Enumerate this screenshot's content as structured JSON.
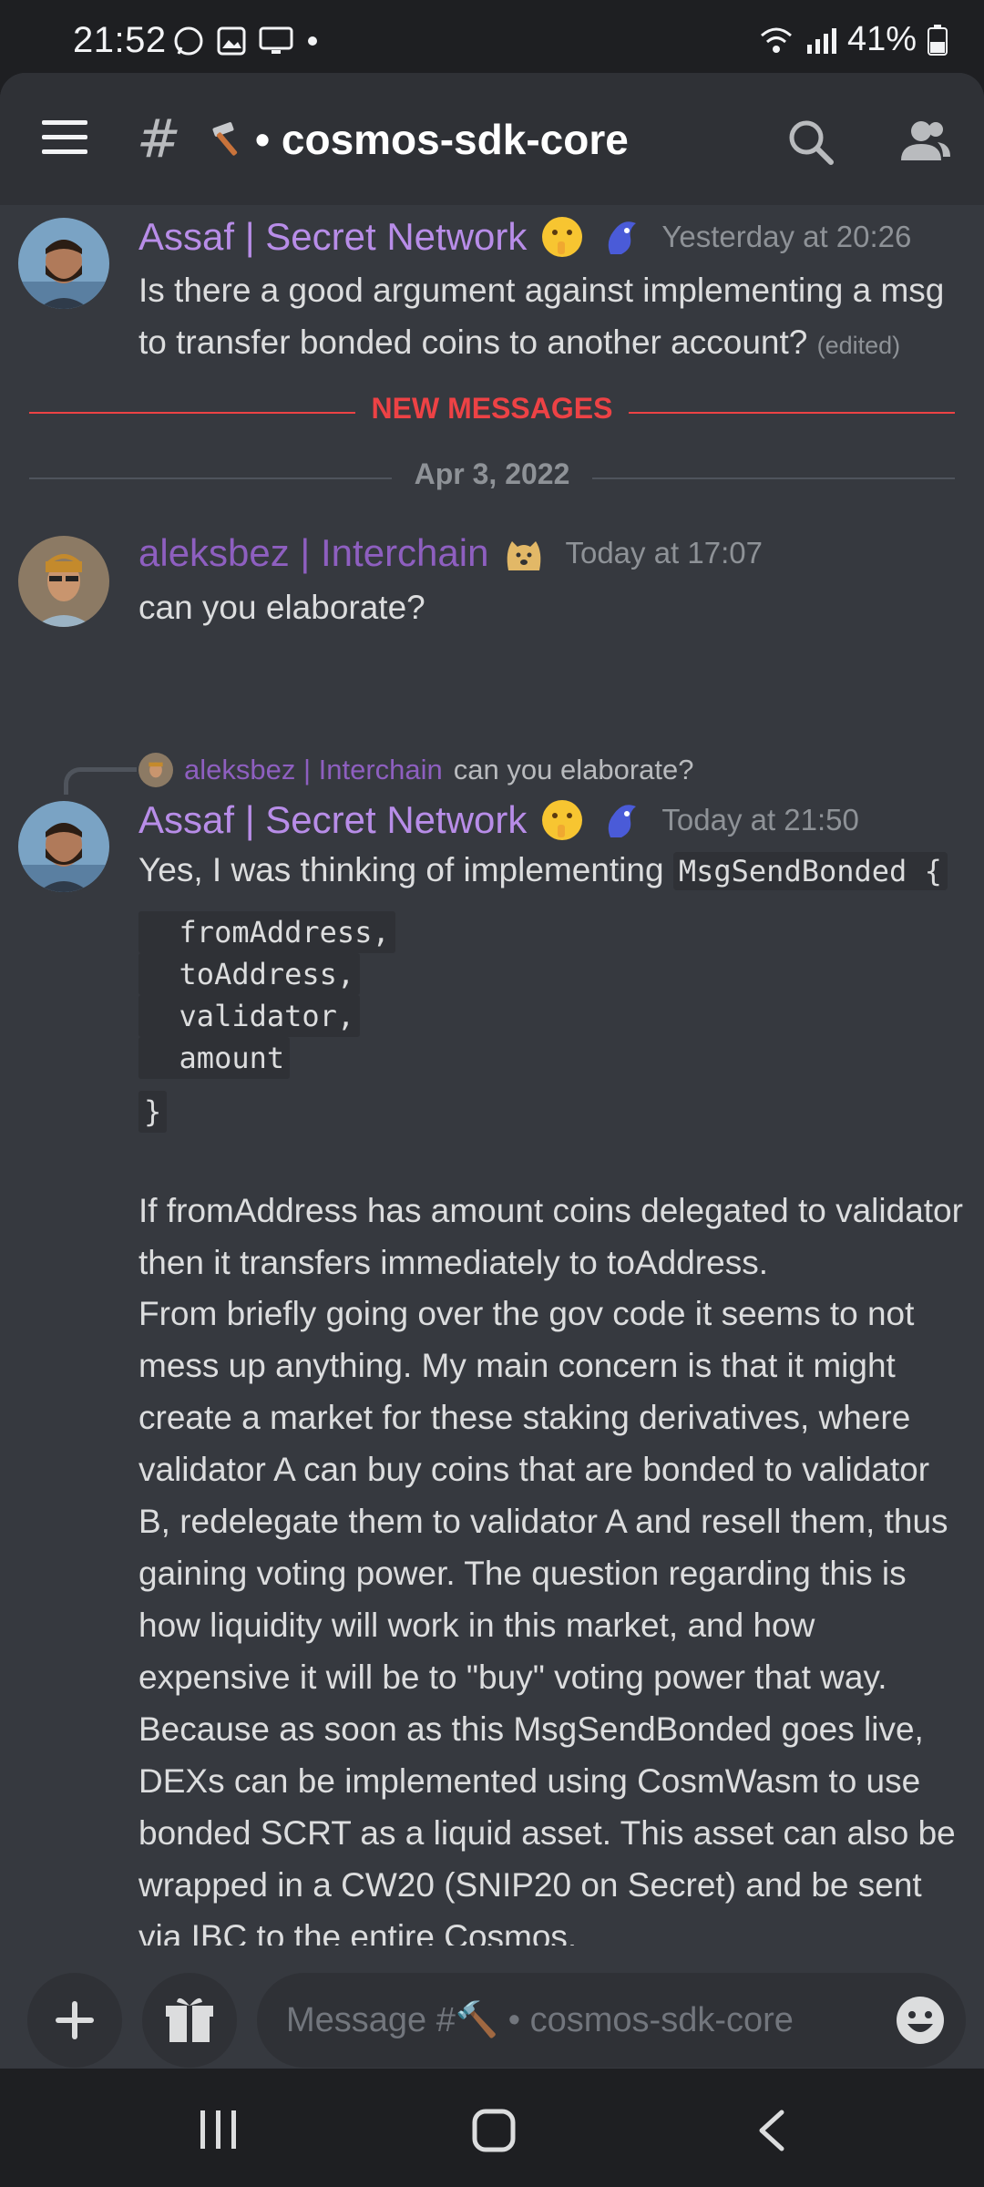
{
  "status_bar": {
    "time": "21:52",
    "battery": "41%"
  },
  "header": {
    "channel_prefix": "#",
    "channel_name": "• cosmos-sdk-core"
  },
  "messages": [
    {
      "author": "Assaf | Secret Network",
      "timestamp": "Yesterday at 20:26",
      "text": "Is there a good argument against implementing a msg to transfer bonded coins to another account?",
      "edited": "(edited)"
    },
    {
      "author": "aleksbez | Interchain",
      "timestamp": "Today at 17:07",
      "text": "can you elaborate?"
    },
    {
      "reply_author": "aleksbez | Interchain",
      "reply_text": "can you elaborate?",
      "author": "Assaf | Secret Network",
      "timestamp": "Today at 21:50",
      "intro": "Yes, I was thinking of implementing",
      "code_first": "MsgSendBonded {",
      "code_lines": [
        "  fromAddress,",
        "  toAddress,",
        "  validator,",
        "  amount",
        "}"
      ],
      "para1": "If fromAddress has amount coins delegated to validator then it transfers immediately to toAddress.",
      "para2": "From briefly going over the gov code it seems to not mess up anything. My main concern is that it might create a market for these staking derivatives, where validator A can buy coins that are bonded to validator B, redelegate them to validator A and resell them, thus gaining voting power. The question regarding this is how liquidity will work in this market, and how expensive it will be to \"buy\" voting power that way. Because as soon as this MsgSendBonded goes live, DEXs can be implemented using CosmWasm to use bonded SCRT as a liquid asset. This asset can also be wrapped in a CW20 (SNIP20 on Secret) and be sent via IBC to the entire Cosmos."
    }
  ],
  "dividers": {
    "new_messages": "NEW MESSAGES",
    "date": "Apr 3, 2022"
  },
  "composer": {
    "placeholder": "Message #🔨 • cosmos-sdk-core"
  },
  "colors": {
    "accent_new": "#ed4245",
    "author": "#b88de8",
    "background": "#36393f"
  },
  "icons": [
    "menu-icon",
    "search-icon",
    "members-icon",
    "plus-icon",
    "gift-icon",
    "emoji-icon",
    "recent-apps-icon",
    "home-icon",
    "back-icon"
  ]
}
